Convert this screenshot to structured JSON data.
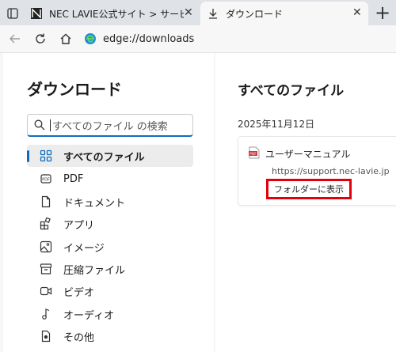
{
  "tabs": [
    {
      "title": "NEC LAVIE公式サイト > サービス&サ",
      "active": false
    },
    {
      "title": "ダウンロード",
      "active": true
    }
  ],
  "toolbar": {
    "address": "edge://downloads"
  },
  "sidebar": {
    "title": "ダウンロード",
    "search_placeholder": "すべてのファイル の検索",
    "items": [
      {
        "label": "すべてのファイル",
        "icon": "grid-icon",
        "active": true
      },
      {
        "label": "PDF",
        "icon": "pdf-icon",
        "active": false
      },
      {
        "label": "ドキュメント",
        "icon": "document-icon",
        "active": false
      },
      {
        "label": "アプリ",
        "icon": "apps-icon",
        "active": false
      },
      {
        "label": "イメージ",
        "icon": "image-icon",
        "active": false
      },
      {
        "label": "圧縮ファイル",
        "icon": "archive-icon",
        "active": false
      },
      {
        "label": "ビデオ",
        "icon": "video-icon",
        "active": false
      },
      {
        "label": "オーディオ",
        "icon": "audio-icon",
        "active": false
      },
      {
        "label": "その他",
        "icon": "other-icon",
        "active": false
      }
    ]
  },
  "main": {
    "title": "すべてのファイル",
    "date_group": "2025年11月12日",
    "download": {
      "file_name": "ユーザーマニュアル",
      "url": "https://support.nec-lavie.jp",
      "action_label": "フォルダーに表示"
    }
  },
  "colors": {
    "accent": "#0f6cbd",
    "highlight": "#e3000b",
    "pdf_red": "#d13438"
  }
}
